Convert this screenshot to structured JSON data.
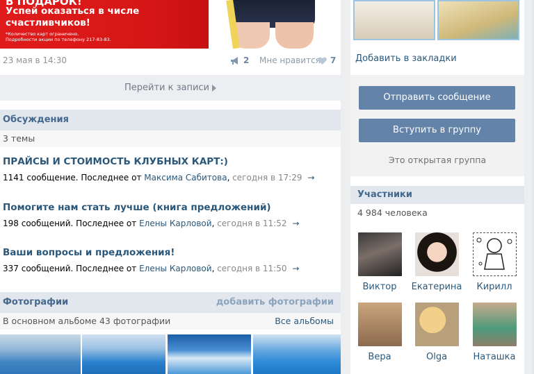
{
  "banner": {
    "line1": "В ПОДАРОК!",
    "line2": "Успей оказаться в числе",
    "line3": "счастливчиков!",
    "small1": "*Количество карт ограничено.",
    "small2": "Подробности акции по телефону 217-83-83."
  },
  "post": {
    "date": "23 мая в 14:30",
    "shares": "2",
    "like_label": "Мне нравится",
    "likes": "7",
    "goto_label": "Перейти к записи"
  },
  "discussions": {
    "title": "Обсуждения",
    "count": "3 темы",
    "topics": [
      {
        "title": "ПРАЙСЫ И СТОИМОСТЬ КЛУБНЫХ КАРТ:)",
        "count": "1141 сообщение.",
        "last_prefix": "Последнее от",
        "author": "Максима Сабитова",
        "time": "сегодня в 17:29",
        "arrow": "→"
      },
      {
        "title": "Помогите нам стать лучше (книга предложений)",
        "count": "198 сообщений.",
        "last_prefix": "Последнее от",
        "author": "Елены Карловой",
        "time": "сегодня в 11:52",
        "arrow": "→"
      },
      {
        "title": "Ваши вопросы и предложения!",
        "count": "337 сообщений.",
        "last_prefix": "Последнее от",
        "author": "Елены Карловой",
        "time": "сегодня в 11:50",
        "arrow": "→"
      }
    ]
  },
  "photos": {
    "title": "Фотографии",
    "add_link": "добавить фотографии",
    "album_info": "В основном альбоме 43 фотографии",
    "all_albums": "Все альбомы"
  },
  "sidebar": {
    "bookmark": "Добавить в закладки",
    "send_message": "Отправить сообщение",
    "join_group": "Вступить в группу",
    "open_group": "Это открытая группа",
    "members_title": "Участники",
    "members_count": "4 984 человека",
    "members": [
      {
        "name": "Виктор"
      },
      {
        "name": "Екатерина"
      },
      {
        "name": "Кирилл"
      },
      {
        "name": "Вера"
      },
      {
        "name": "Olga"
      },
      {
        "name": "Наташка"
      }
    ]
  },
  "colors": {
    "accent": "#6383a8",
    "header_bg": "#e1e7ed",
    "link": "#2b587a",
    "banner_red": "#e01b1b"
  }
}
